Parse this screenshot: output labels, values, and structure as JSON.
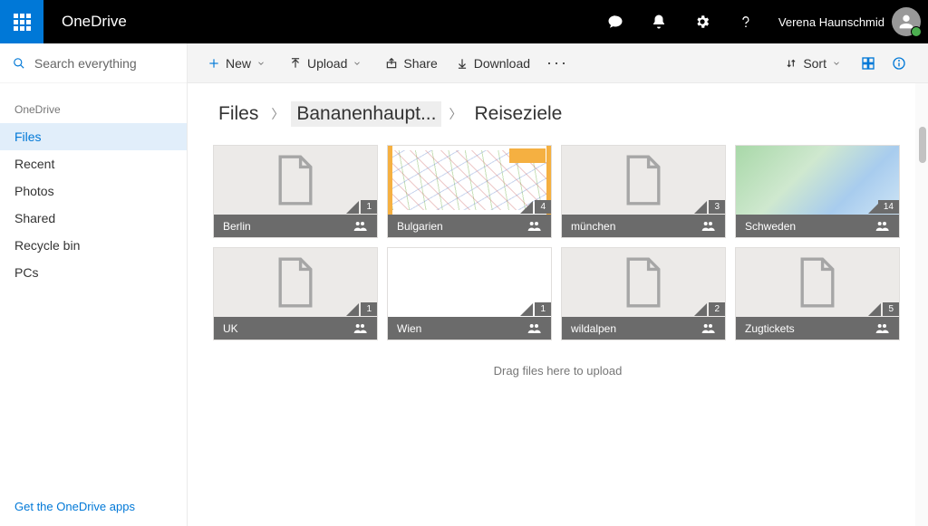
{
  "header": {
    "app_title": "OneDrive",
    "user_name": "Verena Haunschmid"
  },
  "search": {
    "placeholder": "Search everything"
  },
  "sidebar": {
    "title": "OneDrive",
    "items": [
      {
        "label": "Files",
        "active": true
      },
      {
        "label": "Recent"
      },
      {
        "label": "Photos"
      },
      {
        "label": "Shared"
      },
      {
        "label": "Recycle bin"
      },
      {
        "label": "PCs"
      }
    ],
    "bottom_link": "Get the OneDrive apps"
  },
  "commands": {
    "new": "New",
    "upload": "Upload",
    "share": "Share",
    "download": "Download",
    "sort": "Sort"
  },
  "breadcrumb": {
    "root": "Files",
    "mid": "Bananenhaupt...",
    "current": "Reiseziele"
  },
  "folders": [
    {
      "name": "Berlin",
      "count": "1",
      "thumb": "doc"
    },
    {
      "name": "Bulgarien",
      "count": "4",
      "thumb": "map2"
    },
    {
      "name": "münchen",
      "count": "3",
      "thumb": "doc"
    },
    {
      "name": "Schweden",
      "count": "14",
      "thumb": "map"
    },
    {
      "name": "UK",
      "count": "1",
      "thumb": "doc"
    },
    {
      "name": "Wien",
      "count": "1",
      "thumb": "blank"
    },
    {
      "name": "wildalpen",
      "count": "2",
      "thumb": "doc"
    },
    {
      "name": "Zugtickets",
      "count": "5",
      "thumb": "doc"
    }
  ],
  "drop_hint": "Drag files here to upload"
}
